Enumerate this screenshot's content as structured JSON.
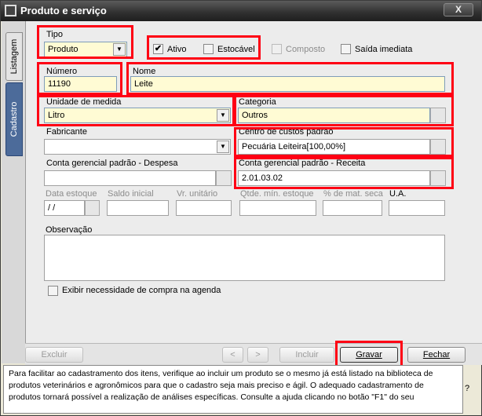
{
  "window": {
    "title": "Produto e serviço",
    "close_label": "X"
  },
  "side_tabs": [
    {
      "label": "Listagem"
    },
    {
      "label": "Cadastro"
    }
  ],
  "form": {
    "tipo": {
      "label": "Tipo",
      "value": "Produto"
    },
    "ativo": {
      "label": "Ativo",
      "checked": true
    },
    "estocavel": {
      "label": "Estocável",
      "checked": false
    },
    "composto": {
      "label": "Composto",
      "checked": false
    },
    "saida_imediata": {
      "label": "Saída imediata",
      "checked": false
    },
    "numero": {
      "label": "Número",
      "value": "11190"
    },
    "nome": {
      "label": "Nome",
      "value": "Leite"
    },
    "unidade": {
      "label": "Unidade de medida",
      "value": "Litro"
    },
    "categoria": {
      "label": "Categoria",
      "value": "Outros"
    },
    "fabricante": {
      "label": "Fabricante",
      "value": ""
    },
    "centro_custos": {
      "label": "Centro de custos padrão",
      "value": "Pecuária  Leiteira[100,00%]"
    },
    "conta_despesa": {
      "label": "Conta gerencial padrão - Despesa",
      "value": ""
    },
    "conta_receita": {
      "label": "Conta gerencial padrão - Receita",
      "value": "2.01.03.02"
    },
    "data_estoque": {
      "label": "Data estoque",
      "value": " /  /"
    },
    "saldo_inicial": {
      "label": "Saldo inicial",
      "value": ""
    },
    "vr_unitario": {
      "label": "Vr. unitário",
      "value": ""
    },
    "qtde_min": {
      "label": "Qtde. mín. estoque",
      "value": ""
    },
    "perc_mat_seca": {
      "label": "% de mat. seca",
      "value": ""
    },
    "ua": {
      "label": "U.A.",
      "value": ""
    },
    "observacao": {
      "label": "Observação",
      "value": ""
    },
    "exibir_necessidade": {
      "label": "Exibir necessidade de compra na agenda",
      "checked": false
    }
  },
  "buttons": {
    "excluir": "Excluir",
    "prev": "<",
    "next": ">",
    "incluir": "Incluir",
    "gravar": "Gravar",
    "fechar": "Fechar"
  },
  "help": {
    "text": "Para facilitar ao cadastramento dos itens, verifique ao incluir um produto se o mesmo já está listado na biblioteca de produtos veterinários e agronômicos para que o cadastro seja mais preciso e ágil. O adequado cadastramento de produtos tornará possível a realização de análises específicas. Consulte a ajuda clicando no botão \"F1\" do seu",
    "question": "?"
  },
  "colors": {
    "highlight": "#ff0014",
    "input_yellow": "#fffbd4",
    "active_tab": "#4c6b9a"
  },
  "icons": {
    "checkmark": "check-icon",
    "dropdown": "chevron-down-icon"
  }
}
